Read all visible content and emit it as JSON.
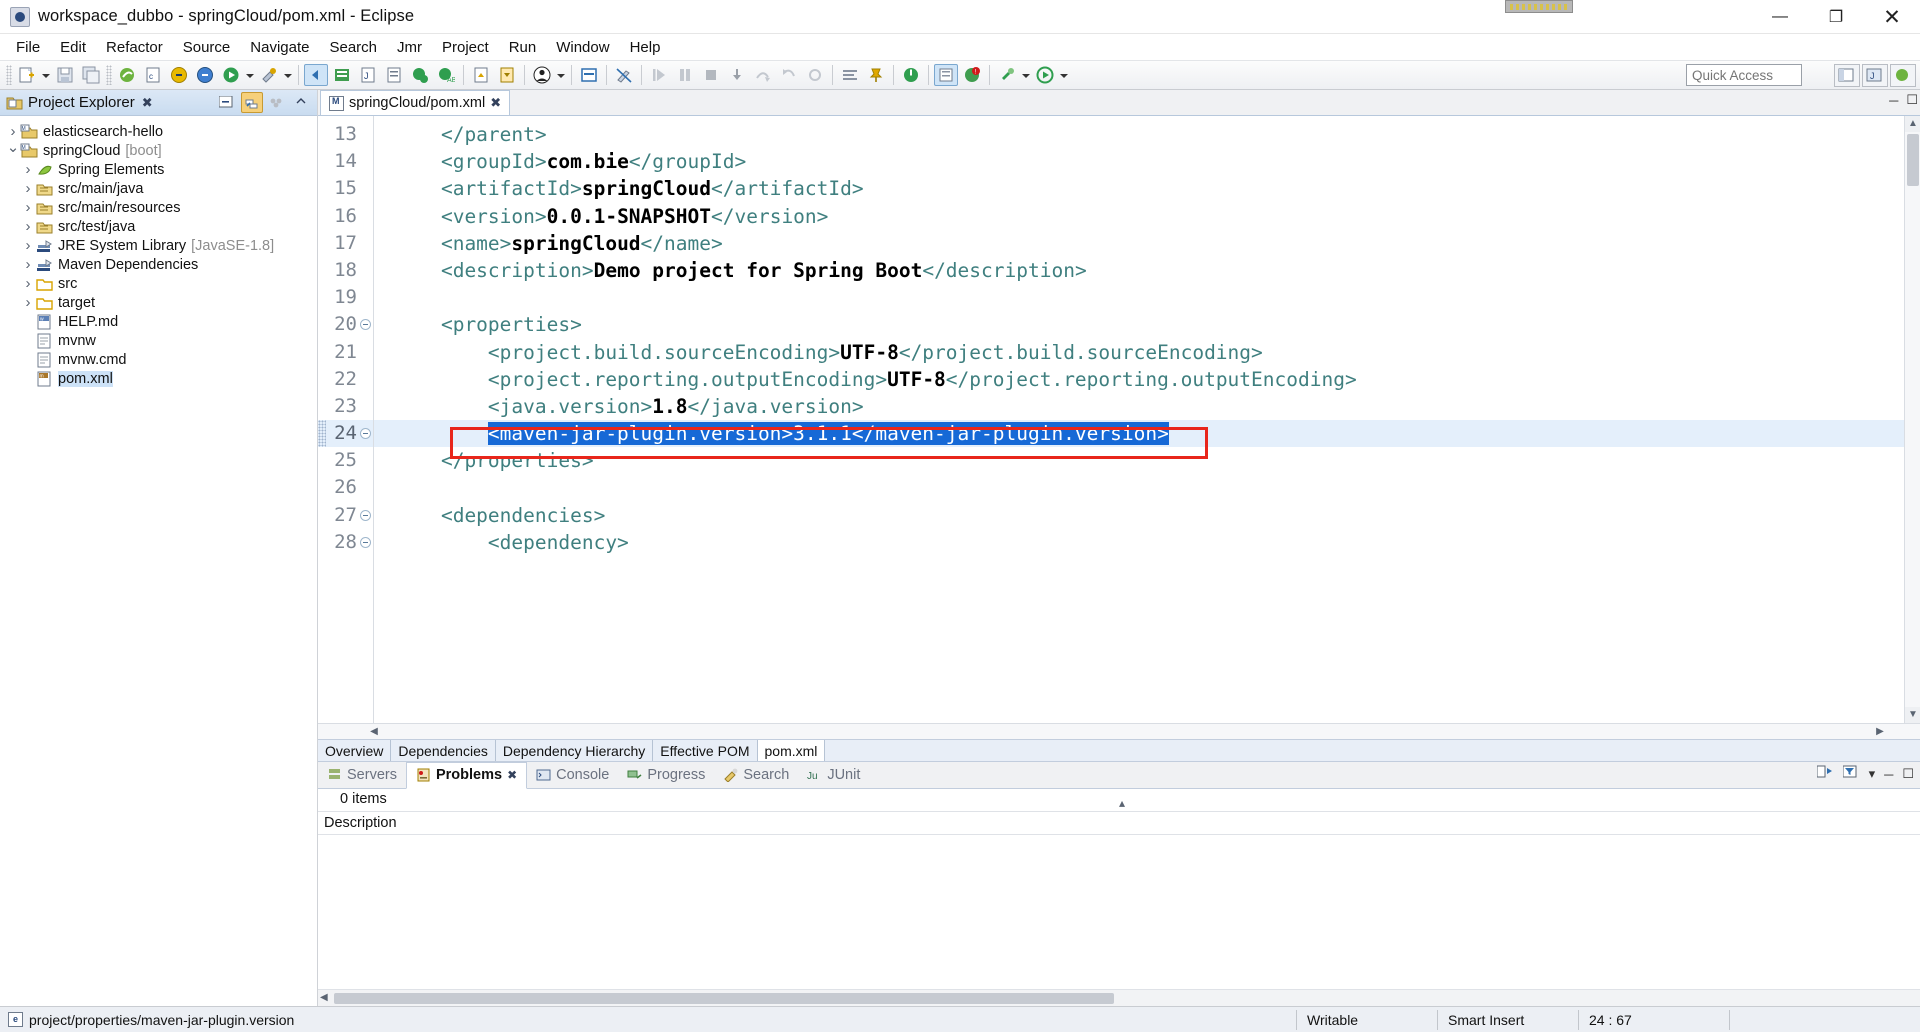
{
  "window": {
    "title": "workspace_dubbo - springCloud/pom.xml - Eclipse",
    "minimize": "—",
    "maximize": "❐",
    "close": "✕"
  },
  "menu": {
    "items": [
      "File",
      "Edit",
      "Refactor",
      "Source",
      "Navigate",
      "Search",
      "Jmr",
      "Project",
      "Run",
      "Window",
      "Help"
    ]
  },
  "toolbar": {
    "quick_access_placeholder": "Quick Access"
  },
  "project_explorer": {
    "title": "Project Explorer",
    "close": "✖",
    "tree": [
      {
        "label": "elasticsearch-hello",
        "sub": "",
        "indent": 0,
        "twist": "closed",
        "icon": "maven-project-icon",
        "selected": false
      },
      {
        "label": "springCloud",
        "sub": "[boot]",
        "indent": 0,
        "twist": "open",
        "icon": "maven-project-icon",
        "selected": false
      },
      {
        "label": "Spring Elements",
        "sub": "",
        "indent": 1,
        "twist": "closed",
        "icon": "spring-icon",
        "selected": false
      },
      {
        "label": "src/main/java",
        "sub": "",
        "indent": 1,
        "twist": "closed",
        "icon": "source-folder-icon",
        "selected": false
      },
      {
        "label": "src/main/resources",
        "sub": "",
        "indent": 1,
        "twist": "closed",
        "icon": "source-folder-icon",
        "selected": false
      },
      {
        "label": "src/test/java",
        "sub": "",
        "indent": 1,
        "twist": "closed",
        "icon": "source-folder-icon",
        "selected": false
      },
      {
        "label": "JRE System Library",
        "sub": "[JavaSE-1.8]",
        "indent": 1,
        "twist": "closed",
        "icon": "library-icon",
        "selected": false
      },
      {
        "label": "Maven Dependencies",
        "sub": "",
        "indent": 1,
        "twist": "closed",
        "icon": "library-icon",
        "selected": false
      },
      {
        "label": "src",
        "sub": "",
        "indent": 1,
        "twist": "closed",
        "icon": "folder-icon",
        "selected": false
      },
      {
        "label": "target",
        "sub": "",
        "indent": 1,
        "twist": "closed",
        "icon": "folder-icon",
        "selected": false
      },
      {
        "label": "HELP.md",
        "sub": "",
        "indent": 1,
        "twist": "none",
        "icon": "markdown-file-icon",
        "selected": false
      },
      {
        "label": "mvnw",
        "sub": "",
        "indent": 1,
        "twist": "none",
        "icon": "file-icon",
        "selected": false
      },
      {
        "label": "mvnw.cmd",
        "sub": "",
        "indent": 1,
        "twist": "none",
        "icon": "file-icon",
        "selected": false
      },
      {
        "label": "pom.xml",
        "sub": "",
        "indent": 1,
        "twist": "none",
        "icon": "maven-pom-icon",
        "selected": true
      }
    ]
  },
  "editor": {
    "tab_label": "springCloud/pom.xml",
    "tab_close": "✖",
    "lines": [
      {
        "num": "13",
        "fold": false,
        "segments": [
          {
            "t": "tag",
            "v": "    </parent>"
          }
        ]
      },
      {
        "num": "14",
        "fold": false,
        "segments": [
          {
            "t": "tag",
            "v": "    <groupId>"
          },
          {
            "t": "txt",
            "v": "com.bie"
          },
          {
            "t": "tag",
            "v": "</groupId>"
          }
        ]
      },
      {
        "num": "15",
        "fold": false,
        "segments": [
          {
            "t": "tag",
            "v": "    <artifactId>"
          },
          {
            "t": "txt",
            "v": "springCloud"
          },
          {
            "t": "tag",
            "v": "</artifactId>"
          }
        ]
      },
      {
        "num": "16",
        "fold": false,
        "segments": [
          {
            "t": "tag",
            "v": "    <version>"
          },
          {
            "t": "txt",
            "v": "0.0.1-SNAPSHOT"
          },
          {
            "t": "tag",
            "v": "</version>"
          }
        ]
      },
      {
        "num": "17",
        "fold": false,
        "segments": [
          {
            "t": "tag",
            "v": "    <name>"
          },
          {
            "t": "txt",
            "v": "springCloud"
          },
          {
            "t": "tag",
            "v": "</name>"
          }
        ]
      },
      {
        "num": "18",
        "fold": false,
        "segments": [
          {
            "t": "tag",
            "v": "    <description>"
          },
          {
            "t": "txt",
            "v": "Demo project for Spring Boot"
          },
          {
            "t": "tag",
            "v": "</description>"
          }
        ]
      },
      {
        "num": "19",
        "fold": false,
        "segments": [
          {
            "t": "tag",
            "v": ""
          }
        ]
      },
      {
        "num": "20",
        "fold": true,
        "segments": [
          {
            "t": "tag",
            "v": "    <properties>"
          }
        ]
      },
      {
        "num": "21",
        "fold": false,
        "segments": [
          {
            "t": "tag",
            "v": "        <project.build.sourceEncoding>"
          },
          {
            "t": "txt",
            "v": "UTF-8"
          },
          {
            "t": "tag",
            "v": "</project.build.sourceEncoding>"
          }
        ]
      },
      {
        "num": "22",
        "fold": false,
        "segments": [
          {
            "t": "tag",
            "v": "        <project.reporting.outputEncoding>"
          },
          {
            "t": "txt",
            "v": "UTF-8"
          },
          {
            "t": "tag",
            "v": "</project.reporting.outputEncoding>"
          }
        ]
      },
      {
        "num": "23",
        "fold": false,
        "segments": [
          {
            "t": "tag",
            "v": "        <java.version>"
          },
          {
            "t": "txt",
            "v": "1.8"
          },
          {
            "t": "tag",
            "v": "</java.version>"
          }
        ]
      },
      {
        "num": "24",
        "fold": true,
        "selected": true,
        "segments": [
          {
            "t": "tag",
            "v": "        "
          },
          {
            "t": "sel",
            "v": "<maven-jar-plugin.version>3.1.1</maven-jar-plugin.version>"
          }
        ]
      },
      {
        "num": "25",
        "fold": false,
        "segments": [
          {
            "t": "tag",
            "v": "    </properties>"
          }
        ]
      },
      {
        "num": "26",
        "fold": false,
        "segments": [
          {
            "t": "tag",
            "v": ""
          }
        ]
      },
      {
        "num": "27",
        "fold": true,
        "segments": [
          {
            "t": "tag",
            "v": "    <dependencies>"
          }
        ]
      },
      {
        "num": "28",
        "fold": true,
        "segments": [
          {
            "t": "tag",
            "v": "        <dependency>"
          }
        ]
      }
    ],
    "subtabs": [
      {
        "label": "Overview",
        "active": false
      },
      {
        "label": "Dependencies",
        "active": false
      },
      {
        "label": "Dependency Hierarchy",
        "active": false
      },
      {
        "label": "Effective POM",
        "active": false
      },
      {
        "label": "pom.xml",
        "active": true
      }
    ]
  },
  "bottom_panel": {
    "tabs": [
      {
        "label": "Servers",
        "icon": "servers-icon",
        "active": false,
        "close": ""
      },
      {
        "label": "Problems",
        "icon": "problems-icon",
        "active": true,
        "close": "✖"
      },
      {
        "label": "Console",
        "icon": "console-icon",
        "active": false,
        "close": ""
      },
      {
        "label": "Progress",
        "icon": "progress-icon",
        "active": false,
        "close": ""
      },
      {
        "label": "Search",
        "icon": "search-icon",
        "active": false,
        "close": ""
      },
      {
        "label": "JUnit",
        "icon": "junit-icon",
        "active": false,
        "close": ""
      }
    ],
    "item_count": "0 items",
    "column_header": "Description"
  },
  "statusbar": {
    "selection_path": "project/properties/maven-jar-plugin.version",
    "writable": "Writable",
    "insert_mode": "Smart Insert",
    "caret_position": "24 : 67"
  }
}
